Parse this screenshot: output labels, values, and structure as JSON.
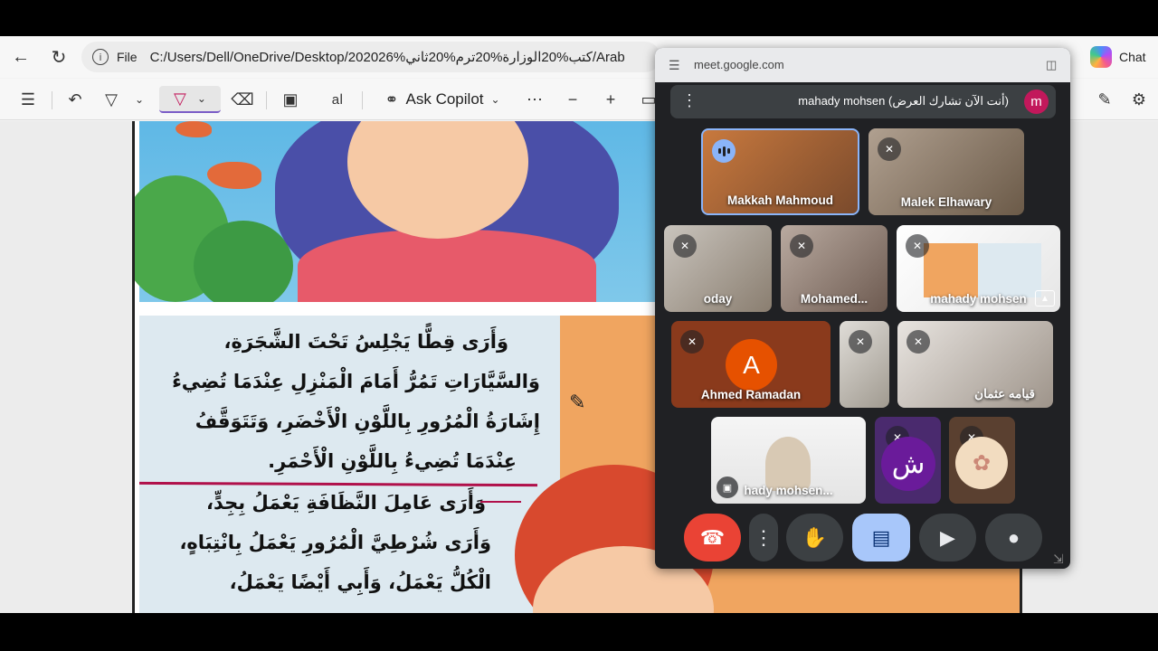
{
  "browser": {
    "address": {
      "scheme_label": "File",
      "url": "C:/Users/Dell/OneDrive/Desktop/202026%كتب%20الوزارة%20ترم%20ثاني/Arab"
    },
    "chat_label": "Chat"
  },
  "pdf_toolbar": {
    "copilot_label": "Ask Copilot"
  },
  "document": {
    "lines_paragraph1": [
      "وَأَرَى قِطًّا يَجْلِسُ تَحْتَ الشَّجَرَةِ،",
      "وَالسَّيَّارَاتِ تَمُرُّ أَمَامَ الْمَنْزِلِ عِنْدَمَا تُضِيءُ",
      "إِشَارَةُ الْمُرُورِ بِاللَّوْنِ الْأَخْضَرِ، وَتَتَوَقَّفُ",
      "عِنْدَمَا تُضِيءُ بِاللَّوْنِ الْأَحْمَرِ."
    ],
    "lines_paragraph2": [
      "وَأَرَى عَامِلَ النَّظَافَةِ يَعْمَلُ بِجِدٍّ،",
      "وَأَرَى شُرْطِيَّ الْمُرُورِ يَعْمَلُ بِانْتِبَاهٍ،",
      "الْكُلُّ يَعْمَلُ، وَأَبِي أَيْضًا يَعْمَلُ،"
    ]
  },
  "meet": {
    "host": "meet.google.com",
    "presenting_banner": "mahady mohsen (أنت الآن تشارك العرض)",
    "presenter_initial": "m",
    "participants": [
      {
        "name": "Makkah Mahmoud",
        "muted": false,
        "speaking": true
      },
      {
        "name": "Malek Elhawary",
        "muted": true
      },
      {
        "name": "oday",
        "muted": true
      },
      {
        "name": "Mohamed...",
        "muted": true
      },
      {
        "name": "mahady mohsen",
        "muted": true
      },
      {
        "name": "Ahmed Ramadan",
        "muted": true,
        "initial": "A"
      },
      {
        "name": "",
        "muted": true
      },
      {
        "name": "قيامه عثمان",
        "muted": true
      },
      {
        "name": "hady mohsen...",
        "muted": false
      },
      {
        "name": "",
        "muted": true,
        "initial": "ش"
      },
      {
        "name": "",
        "muted": true
      }
    ]
  },
  "colors": {
    "meet_bg": "#202124",
    "end_call": "#ea4335",
    "present_active": "#a8c7fa",
    "active_border": "#8ab4f8",
    "annotation_line": "#b0104a"
  }
}
